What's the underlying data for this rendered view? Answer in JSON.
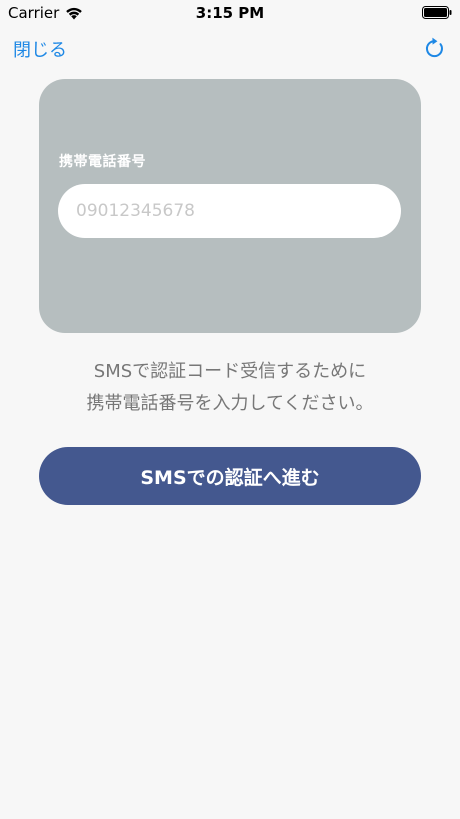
{
  "status_bar": {
    "carrier": "Carrier",
    "time": "3:15 PM"
  },
  "nav": {
    "close_label": "閉じる",
    "refresh_icon": "refresh-icon"
  },
  "form": {
    "phone_label": "携帯電話番号",
    "phone_placeholder": "09012345678",
    "phone_value": ""
  },
  "description": {
    "line1": "SMSで認証コード受信するために",
    "line2": "携帯電話番号を入力してください。"
  },
  "actions": {
    "submit_label": "SMSでの認証へ進む"
  },
  "colors": {
    "accent": "#1e88e5",
    "card_bg": "#b6bebf",
    "button_bg": "#44588f",
    "background": "#f7f7f7"
  }
}
